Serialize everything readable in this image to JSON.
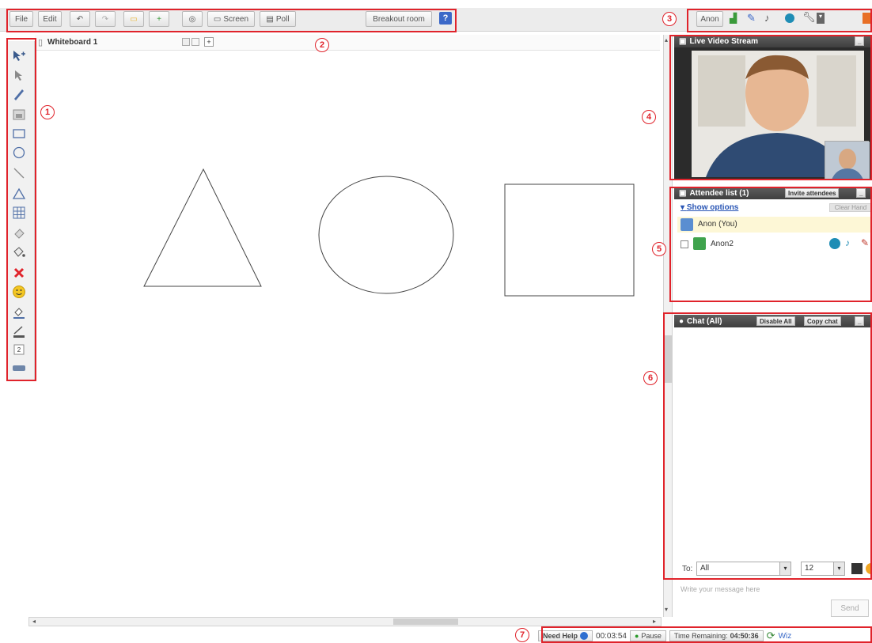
{
  "toolbar": {
    "file": "File",
    "edit": "Edit",
    "screen": "Screen",
    "poll": "Poll",
    "breakout": "Breakout room",
    "help": "?",
    "user": "Anon"
  },
  "callouts": [
    "1",
    "2",
    "3",
    "4",
    "5",
    "6",
    "7"
  ],
  "whiteboard": {
    "tab": "Whiteboard 1"
  },
  "video": {
    "title": "Live Video Stream"
  },
  "attendees": {
    "title": "Attendee list (1)",
    "invite": "Invite attendees",
    "show_options": "Show options",
    "clear_hands": "Clear Hand",
    "self": "Anon (You)",
    "other": "Anon2"
  },
  "chat": {
    "title": "Chat (All)",
    "disable_all": "Disable All",
    "copy_chat": "Copy chat",
    "to_label": "To:",
    "to_value": "All",
    "font_size": "12",
    "placeholder": "Write your message here",
    "send": "Send"
  },
  "status": {
    "need_help": "Need Help",
    "elapsed": "00:03:54",
    "pause": "Pause",
    "remaining_label": "Time Remaining:",
    "remaining_value": "04:50:36",
    "wiz": "Wiz"
  },
  "colors": {
    "accent_red": "#e0232b",
    "panel_dark": "#4a4a4a",
    "highlight_row": "#fdf7d6"
  }
}
